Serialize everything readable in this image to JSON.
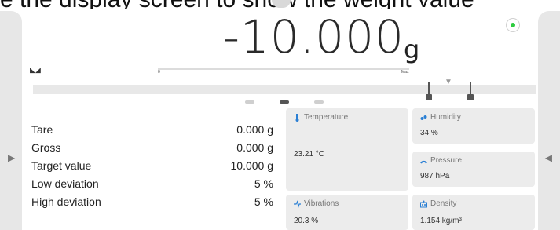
{
  "caption": "e the display screen to show the weight value",
  "weight": {
    "value": "-10.000",
    "unit": "g"
  },
  "stability_marks": "◣◢",
  "bar": {
    "min_label": "0",
    "max_label": "Max"
  },
  "info_rows": [
    {
      "label": "Tare",
      "value": "0.000 g"
    },
    {
      "label": "Gross",
      "value": "0.000 g"
    },
    {
      "label": "Target value",
      "value": "10.000 g"
    },
    {
      "label": "Low deviation",
      "value": "5 %"
    },
    {
      "label": "High deviation",
      "value": "5 %"
    }
  ],
  "widgets": {
    "temperature": {
      "title": "Temperature",
      "value": "23.21 °C"
    },
    "humidity": {
      "title": "Humidity",
      "value": "34 %"
    },
    "pressure": {
      "title": "Pressure",
      "value": "987 hPa"
    },
    "vibrations": {
      "title": "Vibrations",
      "value": "20.3 %"
    },
    "density": {
      "title": "Density",
      "value": "1.154 kg/m³"
    }
  },
  "colors": {
    "status_dot": "#2ecc40",
    "icon_blue": "#2a7fd4",
    "side_panel": "#e7e7e7",
    "card_bg": "#ececec"
  },
  "pager": {
    "pages": 3,
    "active": 2
  }
}
